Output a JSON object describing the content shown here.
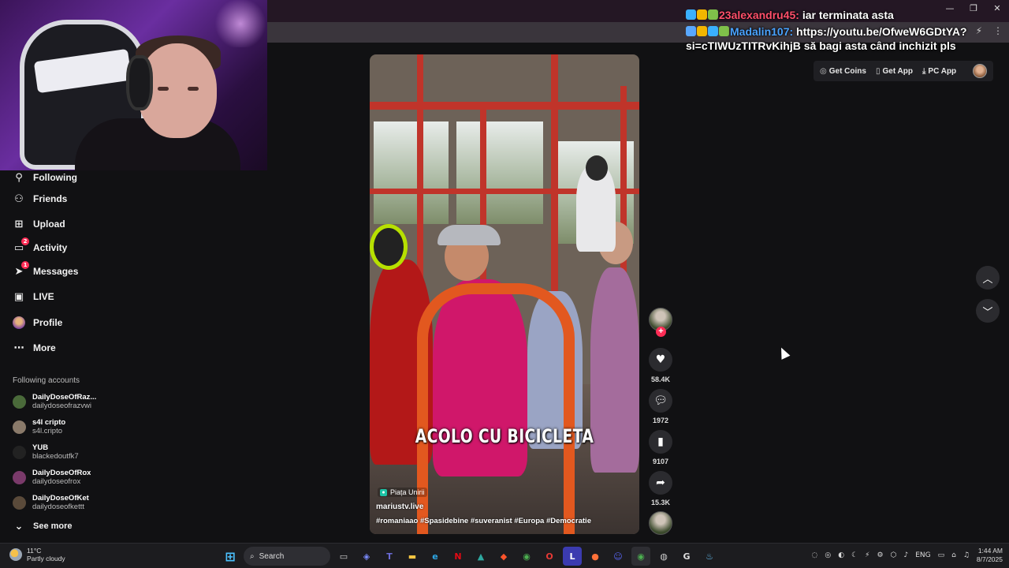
{
  "window": {
    "minimize": "—",
    "restore": "❐",
    "close": "✕"
  },
  "chat": [
    {
      "badges": [
        "#3ab0ff",
        "#f2b600",
        "#7fc14a"
      ],
      "username": "23alexandru45:",
      "message": "iar terminata asta"
    },
    {
      "badges": [
        "#59a8ff",
        "#f2b600",
        "#3ab0ff",
        "#7fc14a"
      ],
      "username": "Madalin107:",
      "message": "https://youtu.be/OfweW6GDtYA?si=cTIWUzTITRvKihjB să bagi asta când inchizit pls"
    }
  ],
  "top_actions": {
    "get_coins": "Get Coins",
    "get_app": "Get App",
    "pc_app": "PC App"
  },
  "sidebar": {
    "items": [
      {
        "label": "Following",
        "icon": "user-follow-icon"
      },
      {
        "label": "Friends",
        "icon": "friends-icon"
      },
      {
        "label": "Upload",
        "icon": "upload-icon"
      },
      {
        "label": "Activity",
        "icon": "activity-icon",
        "badge": "2"
      },
      {
        "label": "Messages",
        "icon": "messages-icon",
        "badge": "1"
      },
      {
        "label": "LIVE",
        "icon": "live-icon"
      },
      {
        "label": "Profile",
        "icon": "profile-avatar"
      },
      {
        "label": "More",
        "icon": "more-icon"
      }
    ],
    "following_title": "Following accounts",
    "accounts": [
      {
        "name": "DailyDoseOfRaz...",
        "handle": "dailydoseofrazvwi",
        "color": "#4a6a3a"
      },
      {
        "name": "s4l cripto",
        "handle": "s4l.cripto",
        "color": "#8a7a6a"
      },
      {
        "name": "YUB",
        "handle": "blackedoutfk7",
        "color": "#222"
      },
      {
        "name": "DailyDoseOfRox",
        "handle": "dailydoseofrox",
        "color": "#7a3a6a"
      },
      {
        "name": "DailyDoseOfKet",
        "handle": "dailydoseofkettt",
        "color": "#5a4a3a"
      }
    ],
    "see_more": "See more"
  },
  "video": {
    "caption": "ACOLO CU BICICLETA",
    "location": "Piața Unirii",
    "author": "mariustv.live",
    "hashtags": "#romaniaao #Spasidebine #suveranist #Europa #Democratie"
  },
  "rail": {
    "likes": "58.4K",
    "comments": "1972",
    "saves": "9107",
    "shares": "15.3K"
  },
  "taskbar": {
    "temperature": "11°C",
    "weather": "Partly cloudy",
    "search": "Search",
    "language": "ENG",
    "time": "1:44 AM",
    "date": "8/7/2025"
  },
  "colors": {
    "accent": "#fe2c55",
    "chat_user1": "#ff4f6a",
    "chat_user2": "#4aa3ff"
  }
}
